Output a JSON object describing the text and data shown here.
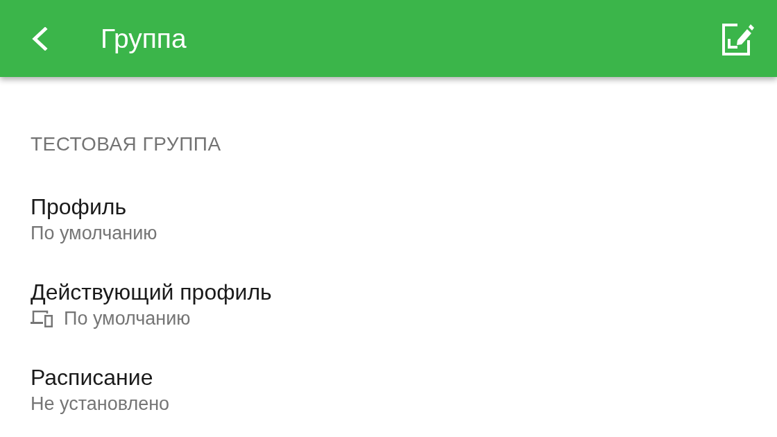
{
  "app_bar": {
    "title": "Группа"
  },
  "section": {
    "header": "ТЕСТОВАЯ ГРУППА",
    "items": [
      {
        "kind": "plain",
        "title": "Профиль",
        "subtitle": "По умолчанию"
      },
      {
        "kind": "device",
        "title": "Действующий профиль",
        "subtitle": "По умолчанию"
      },
      {
        "kind": "plain",
        "title": "Расписание",
        "subtitle": "Не установлено"
      }
    ]
  }
}
